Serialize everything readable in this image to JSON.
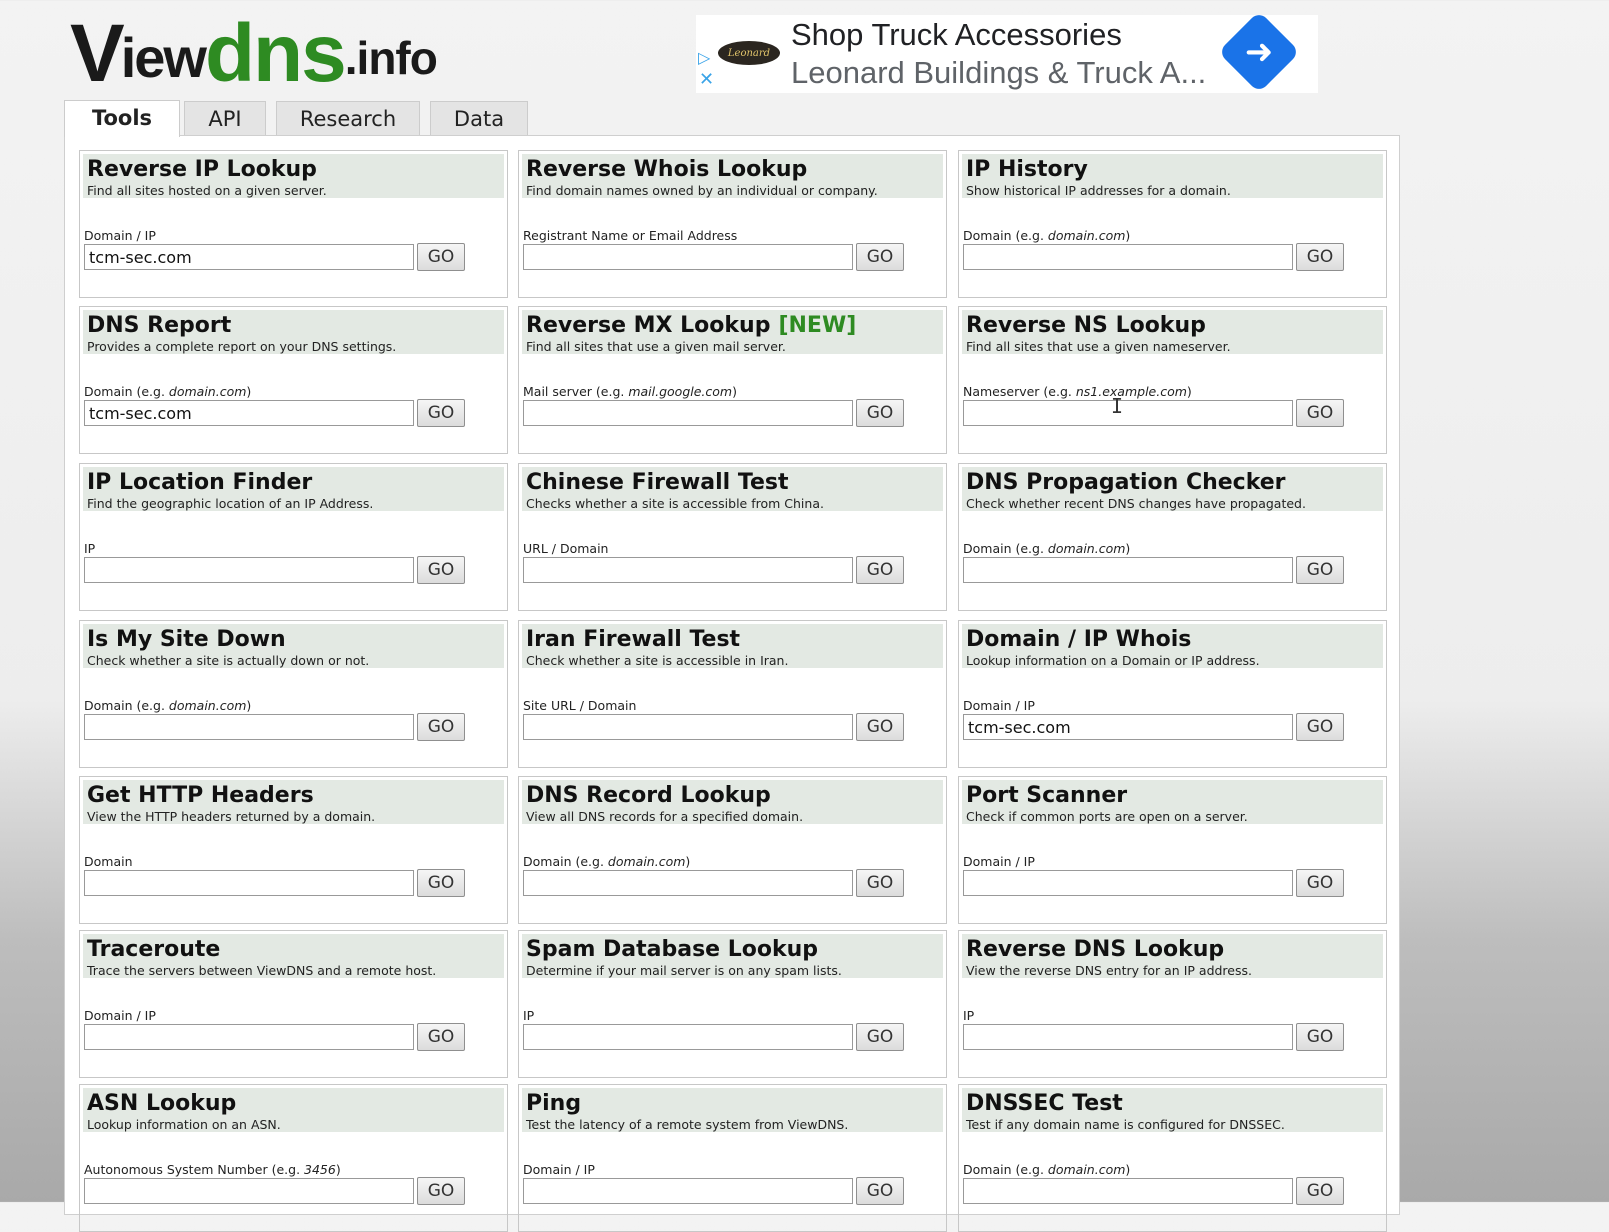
{
  "logo": {
    "v": "V",
    "iew": "iew",
    "dns": "dns",
    "info": ".info"
  },
  "ad": {
    "title": "Shop Truck Accessories",
    "subtitle": "Leonard Buildings & Truck A...",
    "brand_badge": "Leonard",
    "adchoices_icon": "play-triangle-icon",
    "close_icon": "close-icon",
    "arrow_icon": "directions-arrow-icon",
    "arrow_color": "#1a73e8"
  },
  "tabs": [
    {
      "label": "Tools",
      "active": true
    },
    {
      "label": "API",
      "active": false
    },
    {
      "label": "Research",
      "active": false
    },
    {
      "label": "Data",
      "active": false
    }
  ],
  "colors": {
    "accent_green": "#2e8b22",
    "card_header": "#e3e9e3"
  },
  "tools": [
    {
      "title": "Reverse IP Lookup",
      "desc": "Find all sites hosted on a given server.",
      "label": "Domain / IP",
      "value": "tcm-sec.com",
      "go": "GO"
    },
    {
      "title": "Reverse Whois Lookup",
      "desc": "Find domain names owned by an individual or company.",
      "label": "Registrant Name or Email Address",
      "value": "",
      "go": "GO"
    },
    {
      "title": "IP History",
      "desc": "Show historical IP addresses for a domain.",
      "label": "Domain (e.g. ",
      "label_example": "domain.com",
      "label_after": ")",
      "value": "",
      "go": "GO"
    },
    {
      "title": "DNS Report",
      "desc": "Provides a complete report on your DNS settings.",
      "label": "Domain (e.g. ",
      "label_example": "domain.com",
      "label_after": ")",
      "value": "tcm-sec.com",
      "go": "GO"
    },
    {
      "title": "Reverse MX Lookup",
      "badge": "[NEW]",
      "desc": "Find all sites that use a given mail server.",
      "label": "Mail server (e.g. ",
      "label_example": "mail.google.com",
      "label_after": ")",
      "value": "",
      "go": "GO"
    },
    {
      "title": "Reverse NS Lookup",
      "desc": "Find all sites that use a given nameserver.",
      "label": "Nameserver (e.g. ",
      "label_example": "ns1.example.com",
      "label_after": ")",
      "value": "",
      "go": "GO"
    },
    {
      "title": "IP Location Finder",
      "desc": "Find the geographic location of an IP Address.",
      "label": "IP",
      "value": "",
      "go": "GO"
    },
    {
      "title": "Chinese Firewall Test",
      "desc": "Checks whether a site is accessible from China.",
      "label": "URL / Domain",
      "value": "",
      "go": "GO"
    },
    {
      "title": "DNS Propagation Checker",
      "desc": "Check whether recent DNS changes have propagated.",
      "label": "Domain (e.g. ",
      "label_example": "domain.com",
      "label_after": ")",
      "value": "",
      "go": "GO"
    },
    {
      "title": "Is My Site Down",
      "desc": "Check whether a site is actually down or not.",
      "label": "Domain (e.g. ",
      "label_example": "domain.com",
      "label_after": ")",
      "value": "",
      "go": "GO"
    },
    {
      "title": "Iran Firewall Test",
      "desc": "Check whether a site is accessible in Iran.",
      "label": "Site URL / Domain",
      "value": "",
      "go": "GO"
    },
    {
      "title": "Domain / IP Whois",
      "desc": "Lookup information on a Domain or IP address.",
      "label": "Domain / IP",
      "value": "tcm-sec.com",
      "go": "GO"
    },
    {
      "title": "Get HTTP Headers",
      "desc": "View the HTTP headers returned by a domain.",
      "label": "Domain",
      "value": "",
      "go": "GO"
    },
    {
      "title": "DNS Record Lookup",
      "desc": "View all DNS records for a specified domain.",
      "label": "Domain (e.g. ",
      "label_example": "domain.com",
      "label_after": ")",
      "value": "",
      "go": "GO"
    },
    {
      "title": "Port Scanner",
      "desc": "Check if common ports are open on a server.",
      "label": "Domain / IP",
      "value": "",
      "go": "GO"
    },
    {
      "title": "Traceroute",
      "desc": "Trace the servers between ViewDNS and a remote host.",
      "label": "Domain / IP",
      "value": "",
      "go": "GO"
    },
    {
      "title": "Spam Database Lookup",
      "desc": "Determine if your mail server is on any spam lists.",
      "label": "IP",
      "value": "",
      "go": "GO"
    },
    {
      "title": "Reverse DNS Lookup",
      "desc": "View the reverse DNS entry for an IP address.",
      "label": "IP",
      "value": "",
      "go": "GO"
    },
    {
      "title": "ASN Lookup",
      "desc": "Lookup information on an ASN.",
      "label": "Autonomous System Number (e.g. ",
      "label_example": "3456",
      "label_after": ")",
      "value": "",
      "go": "GO"
    },
    {
      "title": "Ping",
      "desc": "Test the latency of a remote system from ViewDNS.",
      "label": "Domain / IP",
      "value": "",
      "go": "GO"
    },
    {
      "title": "DNSSEC Test",
      "desc": "Test if any domain name is configured for DNSSEC.",
      "label": "Domain (e.g. ",
      "label_example": "domain.com",
      "label_after": ")",
      "value": "",
      "go": "GO"
    }
  ]
}
